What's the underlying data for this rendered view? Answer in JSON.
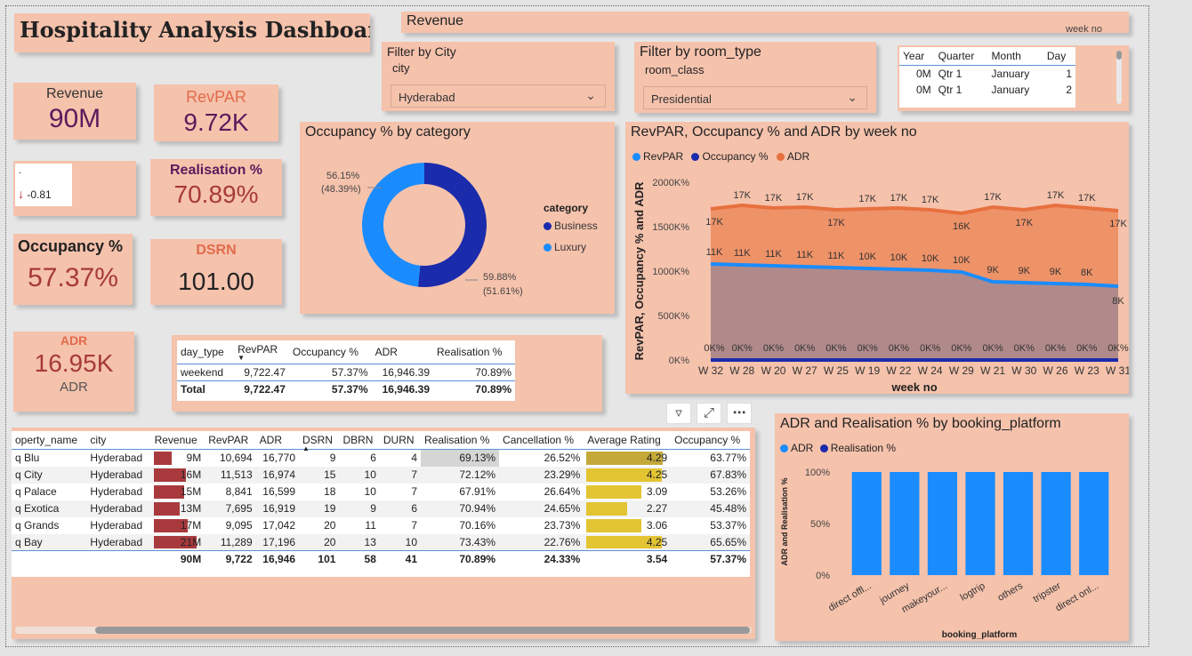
{
  "dashboard": {
    "title": "Hospitality Analysis Dashboard",
    "revenue_header": "Revenue",
    "revenue_header_clip": "week no"
  },
  "kpis": {
    "revenue": {
      "label": "Revenue",
      "value": "90M"
    },
    "revpar": {
      "label": "RevPAR",
      "value": "9.72K"
    },
    "small_card": {
      "label": ".",
      "value": "-0.81"
    },
    "realisation": {
      "label": "Realisation %",
      "value": "70.89%"
    },
    "occupancy": {
      "label": "Occupancy %",
      "value": "57.37%"
    },
    "dsrn": {
      "label": "DSRN",
      "value": "101.00"
    },
    "adr": {
      "label": "ADR",
      "value": "16.95K",
      "sub": "ADR"
    }
  },
  "colors": {
    "card_bg": "#f5c2ac",
    "purple": "#5c1a5c",
    "red": "#a63a3a",
    "orange_label": "#e26b4c",
    "dark_blue": "#1a2bab",
    "light_blue": "#1a8cff",
    "bar_red": "#a83a3e",
    "bar_yellow": "#e3c432"
  },
  "filters": {
    "city": {
      "title": "Filter by City",
      "label": "city",
      "value": "Hyderabad"
    },
    "room": {
      "title": "Filter by room_type",
      "label": "room_class",
      "value": "Presidential"
    }
  },
  "date_table": {
    "headers": [
      "Year",
      "Quarter",
      "Month",
      "Day"
    ],
    "rows": [
      [
        "0M",
        "Qtr 1",
        "January",
        "1"
      ],
      [
        "0M",
        "Qtr 1",
        "January",
        "2"
      ]
    ]
  },
  "donut": {
    "title": "Occupancy % by category",
    "legend_title": "category",
    "slices": [
      {
        "name": "Business",
        "value": 59.88,
        "label": "59.88%",
        "sub": "(51.61%)",
        "color": "#1a2bab"
      },
      {
        "name": "Luxury",
        "value": 56.15,
        "label": "56.15%",
        "sub": "(48.39%)",
        "color": "#1a8cff"
      }
    ]
  },
  "chart_data": {
    "type": "area",
    "title": "RevPAR, Occupancy % and ADR by week no",
    "xlabel": "week no",
    "ylabel": "RevPAR, Occupancy % and ADR",
    "categories": [
      "W 32",
      "W 28",
      "W 20",
      "W 27",
      "W 25",
      "W 19",
      "W 22",
      "W 24",
      "W 29",
      "W 21",
      "W 30",
      "W 26",
      "W 23",
      "W 31"
    ],
    "y_ticks": [
      "0K%",
      "500K%",
      "1000K%",
      "1500K%",
      "2000K%"
    ],
    "ylim": [
      0,
      2000
    ],
    "series": [
      {
        "name": "ADR",
        "color": "#e8703f",
        "values": [
          1700,
          1740,
          1710,
          1720,
          1690,
          1700,
          1710,
          1690,
          1650,
          1720,
          1690,
          1740,
          1710,
          1680
        ],
        "labels": [
          "17K",
          "17K",
          "17K",
          "17K",
          "17K",
          "17K",
          "17K",
          "17K",
          "16K",
          "17K",
          "17K",
          "17K",
          "17K",
          "17K"
        ]
      },
      {
        "name": "RevPAR",
        "color": "#1a8cff",
        "values": [
          1080,
          1070,
          1060,
          1050,
          1040,
          1030,
          1020,
          1010,
          990,
          880,
          870,
          860,
          850,
          830
        ],
        "labels": [
          "11K",
          "11K",
          "11K",
          "11K",
          "11K",
          "10K",
          "10K",
          "10K",
          "10K",
          "9K",
          "9K",
          "9K",
          "8K",
          "8K"
        ]
      },
      {
        "name": "Occupancy %",
        "color": "#1a2bab",
        "values": [
          0.6,
          0.6,
          0.6,
          0.6,
          0.6,
          0.6,
          0.6,
          0.6,
          0.6,
          0.6,
          0.6,
          0.6,
          0.6,
          0.6
        ],
        "labels": [
          "0K%",
          "0K%",
          "0K%",
          "0K%",
          "0K%",
          "0K%",
          "0K%",
          "0K%",
          "0K%",
          "0K%",
          "0K%",
          "0K%",
          "0K%",
          "0K%"
        ]
      }
    ],
    "legend": [
      "RevPAR",
      "Occupancy %",
      "ADR"
    ]
  },
  "daytype_table": {
    "headers": [
      "day_type",
      "RevPAR",
      "Occupancy %",
      "ADR",
      "Realisation %"
    ],
    "rows": [
      [
        "weekend",
        "9,722.47",
        "57.37%",
        "16,946.39",
        "70.89%"
      ]
    ],
    "total": [
      "Total",
      "9,722.47",
      "57.37%",
      "16,946.39",
      "70.89%"
    ]
  },
  "property_table": {
    "headers": [
      "operty_name",
      "city",
      "Revenue",
      "RevPAR",
      "ADR",
      "DSRN",
      "DBRN",
      "DURN",
      "Realisation %",
      "Cancellation %",
      "Average Rating",
      "Occupancy %"
    ],
    "rows": [
      {
        "name": "q Blu",
        "city": "Hyderabad",
        "rev": "9M",
        "rev_v": 9,
        "revpar": "10,694",
        "adr": "16,770",
        "dsrn": "9",
        "dbrn": "6",
        "durn": "4",
        "real": "69.13%",
        "canc": "26.52%",
        "rating": "4.29",
        "rating_v": 4.29,
        "occ": "63.77%"
      },
      {
        "name": "q City",
        "city": "Hyderabad",
        "rev": "16M",
        "rev_v": 16,
        "revpar": "11,513",
        "adr": "16,974",
        "dsrn": "15",
        "dbrn": "10",
        "durn": "7",
        "real": "72.12%",
        "canc": "23.29%",
        "rating": "4.25",
        "rating_v": 4.25,
        "occ": "67.83%"
      },
      {
        "name": "q Palace",
        "city": "Hyderabad",
        "rev": "15M",
        "rev_v": 15,
        "revpar": "8,841",
        "adr": "16,599",
        "dsrn": "18",
        "dbrn": "10",
        "durn": "7",
        "real": "67.91%",
        "canc": "26.64%",
        "rating": "3.09",
        "rating_v": 3.09,
        "occ": "53.26%"
      },
      {
        "name": "q Exotica",
        "city": "Hyderabad",
        "rev": "13M",
        "rev_v": 13,
        "revpar": "7,695",
        "adr": "16,919",
        "dsrn": "19",
        "dbrn": "9",
        "durn": "6",
        "real": "70.94%",
        "canc": "24.65%",
        "rating": "2.27",
        "rating_v": 2.27,
        "occ": "45.48%"
      },
      {
        "name": "q Grands",
        "city": "Hyderabad",
        "rev": "17M",
        "rev_v": 17,
        "revpar": "9,095",
        "adr": "17,042",
        "dsrn": "20",
        "dbrn": "11",
        "durn": "7",
        "real": "70.16%",
        "canc": "23.73%",
        "rating": "3.06",
        "rating_v": 3.06,
        "occ": "53.37%"
      },
      {
        "name": "q Bay",
        "city": "Hyderabad",
        "rev": "21M",
        "rev_v": 21,
        "revpar": "11,289",
        "adr": "17,196",
        "dsrn": "20",
        "dbrn": "13",
        "durn": "10",
        "real": "73.43%",
        "canc": "22.76%",
        "rating": "4.25",
        "rating_v": 4.25,
        "occ": "65.65%"
      }
    ],
    "total": {
      "rev": "90M",
      "revpar": "9,722",
      "adr": "16,946",
      "dsrn": "101",
      "dbrn": "58",
      "durn": "41",
      "real": "70.89%",
      "canc": "24.33%",
      "rating": "3.54",
      "occ": "57.37%"
    }
  },
  "bar_chart": {
    "title": "ADR and Realisation % by booking_platform",
    "legend": [
      "ADR",
      "Realisation %"
    ],
    "ylabel": "ADR and Realisation %",
    "xlabel": "booking_platform",
    "y_ticks": [
      "0%",
      "50%",
      "100%"
    ],
    "categories": [
      "direct offl...",
      "journey",
      "makeyour...",
      "logtrip",
      "others",
      "tripster",
      "direct onl..."
    ],
    "values": [
      100,
      100,
      100,
      100,
      100,
      100,
      100
    ]
  }
}
